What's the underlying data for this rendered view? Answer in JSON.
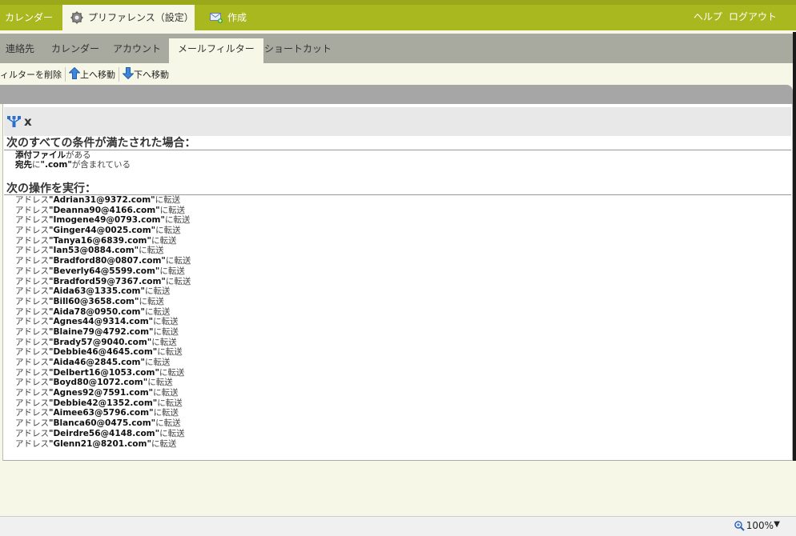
{
  "topbar": {
    "tab_calendar": "カレンダー",
    "tab_prefs": "プリファレンス（設定）",
    "tab_compose": "作成",
    "link_help": "ヘルプ",
    "link_logout": "ログアウト"
  },
  "subtabs": [
    "連絡先",
    "カレンダー",
    "アカウント",
    "メールフィルター",
    "ショートカット"
  ],
  "toolbar": {
    "delete_filter": "ィルターを削除",
    "move_up": "上へ移動",
    "move_down": "下へ移動"
  },
  "filter": {
    "name": "x",
    "conditions_title": "次のすべての条件が満たされた場合：",
    "conditions": [
      {
        "bold": "添付ファイル",
        "text": "がある"
      },
      {
        "bold": "宛先",
        "text": "に",
        "bold2": "\".com\"",
        "text2": "が含まれている"
      }
    ],
    "actions_title": "次の操作を実行：",
    "action_prefix": "アドレス",
    "action_suffix": "に転送",
    "addresses": [
      "Adrian31@9372.com",
      "Deanna90@4166.com",
      "Imogene49@0793.com",
      "Ginger44@0025.com",
      "Tanya16@6839.com",
      "Ian53@0884.com",
      "Bradford80@0807.com",
      "Beverly64@5599.com",
      "Bradford59@7367.com",
      "Aida63@1335.com",
      "Bill60@3658.com",
      "Aida78@0950.com",
      "Agnes44@9314.com",
      "Blaine79@4792.com",
      "Brady57@9040.com",
      "Debbie46@4645.com",
      "Aida46@2845.com",
      "Delbert16@1053.com",
      "Boyd80@1072.com",
      "Agnes92@7591.com",
      "Debbie42@1352.com",
      "Aimee63@5796.com",
      "Blanca60@0475.com",
      "Deirdre56@4148.com",
      "Glenn21@8201.com"
    ]
  },
  "status": {
    "zoom": "100%"
  }
}
